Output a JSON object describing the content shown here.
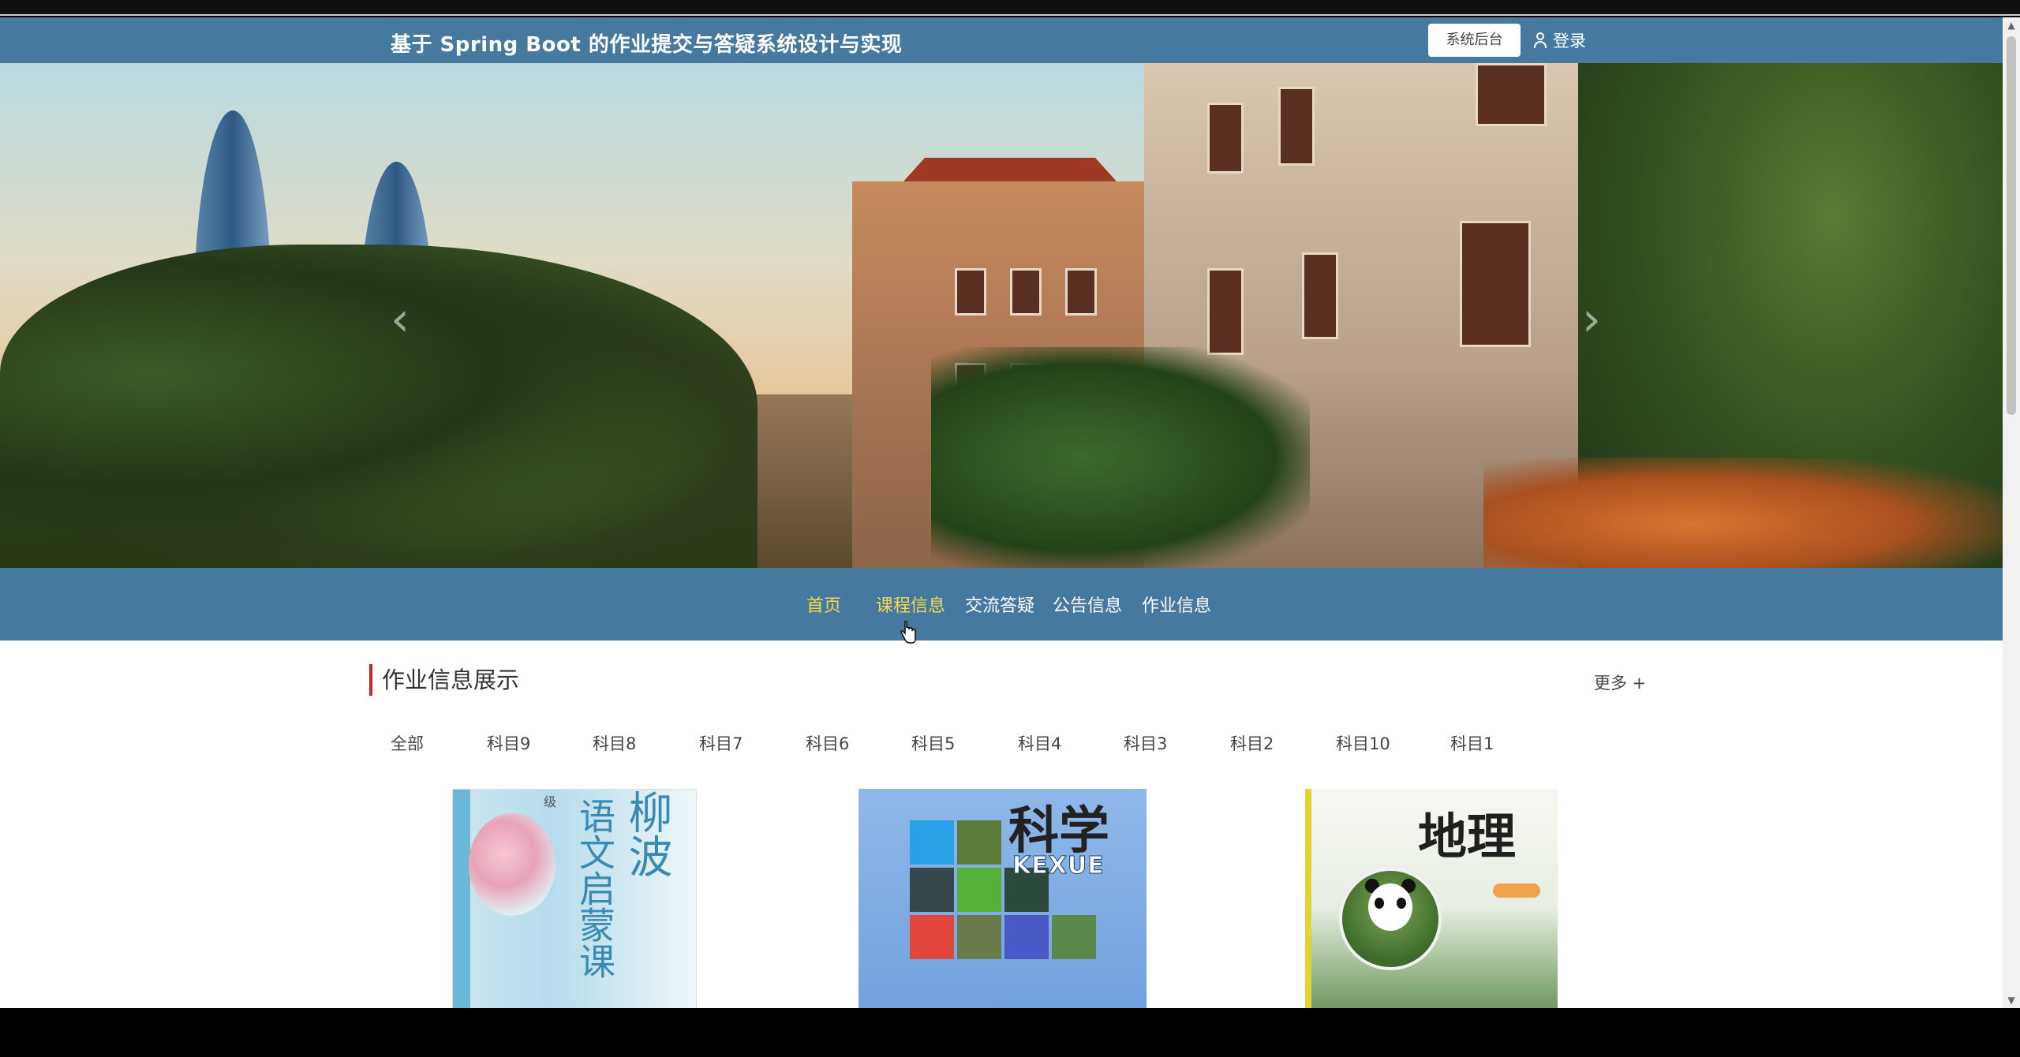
{
  "header": {
    "site_title": "基于 Spring Boot 的作业提交与答疑系统设计与实现",
    "admin_button": "系统后台",
    "login_label": "登录"
  },
  "carousel": {
    "prev_icon": "chevron-left-icon",
    "next_icon": "chevron-right-icon"
  },
  "nav": {
    "items": [
      {
        "label": "首页",
        "active": true
      },
      {
        "label": "课程信息",
        "active": true
      },
      {
        "label": "交流答疑",
        "active": false
      },
      {
        "label": "公告信息",
        "active": false
      },
      {
        "label": "作业信息",
        "active": false
      }
    ]
  },
  "section": {
    "title": "作业信息展示",
    "more_label": "更多 +",
    "tabs": [
      "全部",
      "科目9",
      "科目8",
      "科目7",
      "科目6",
      "科目5",
      "科目4",
      "科目3",
      "科目2",
      "科目10",
      "科目1"
    ]
  },
  "cards": [
    {
      "cover_text": [
        "语文启蒙课",
        "柳波"
      ],
      "badge": "级"
    },
    {
      "cover_title": "科学",
      "cover_sub": "KEXUE"
    },
    {
      "cover_title": "地理"
    }
  ],
  "colors": {
    "header_bg": "#45799f",
    "nav_active": "#f5d84e",
    "section_accent": "#d0202c"
  }
}
